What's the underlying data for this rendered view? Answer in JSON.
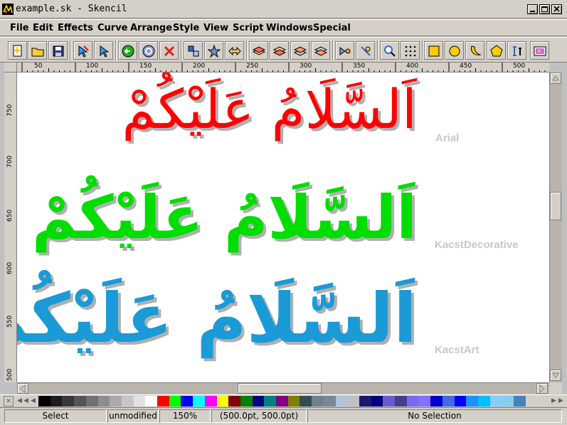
{
  "window": {
    "title": "example.sk - Skencil"
  },
  "menubar": {
    "items": [
      "File",
      "Edit",
      "Effects",
      "Curve",
      "Arrange",
      "Style",
      "View",
      "Script",
      "Windows",
      "Special"
    ]
  },
  "toolbar": {
    "icons": [
      "new-document-icon",
      "open-folder-icon",
      "save-disk-icon",
      "edit-pointer-icon",
      "select-arrow-icon",
      "back-circle-icon",
      "forward-circle-icon",
      "delete-x-icon",
      "group-icon",
      "ungroup-star-icon",
      "combine-icon",
      "raise-icon",
      "lower-icon",
      "to-top-icon",
      "to-bottom-icon",
      "blend-icon",
      "snap-icon",
      "zoom-icon",
      "grid-icon",
      "rectangle-tool-icon",
      "ellipse-tool-icon",
      "curve-tool-icon",
      "polygon-tool-icon",
      "text-tool-icon",
      "image-tool-icon"
    ]
  },
  "ruler": {
    "h_labels": [
      "50",
      "100",
      "150",
      "200",
      "250",
      "300",
      "350",
      "400",
      "450",
      "500"
    ],
    "v_labels": [
      "750",
      "700",
      "650",
      "600",
      "550",
      "500"
    ]
  },
  "canvas": {
    "samples": [
      {
        "text": "اَلسَّلَامُ عَلَيْكُمْ",
        "font_label": "Arial",
        "color": "#ff0000"
      },
      {
        "text": "اَلسَّلَامُ عَلَيْكُمْ",
        "font_label": "KacstDecorative",
        "color": "#00dd00"
      },
      {
        "text": "اَلسَّلَامُ عَلَيْكُمْ",
        "font_label": "KacstArt",
        "color": "#1a9ad6"
      }
    ]
  },
  "palette": {
    "colors": [
      "#000000",
      "#1c1c1c",
      "#383838",
      "#555555",
      "#717171",
      "#8d8d8d",
      "#aaaaaa",
      "#c6c6c6",
      "#e2e2e2",
      "#ffffff",
      "#ff0000",
      "#00ff00",
      "#0000ff",
      "#00ffff",
      "#ff00ff",
      "#ffff00",
      "#800000",
      "#008000",
      "#000080",
      "#008080",
      "#800080",
      "#808000",
      "#2f4f4f",
      "#708090",
      "#778899",
      "#b0c4de",
      "#c0c0c0",
      "#191970",
      "#000080",
      "#6a5acd",
      "#483d8b",
      "#7b68ee",
      "#8470ff",
      "#0000cd",
      "#4169e1",
      "#0000ff",
      "#1e90ff",
      "#00bfff",
      "#87cefa",
      "#87ceeb",
      "#4682b4"
    ]
  },
  "statusbar": {
    "mode": "Select",
    "state": "unmodified",
    "zoom": "150%",
    "position": "(500.0pt, 500.0pt)",
    "selection": "No Selection"
  }
}
